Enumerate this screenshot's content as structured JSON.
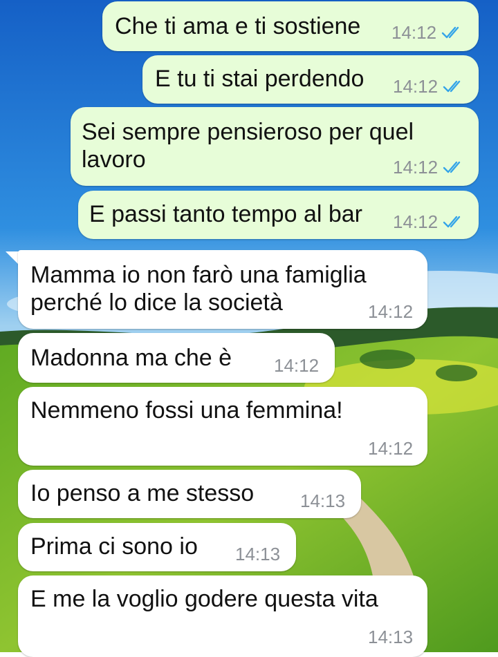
{
  "chat": {
    "colors": {
      "outgoing_bubble": "#e7fdd8",
      "incoming_bubble": "#ffffff",
      "timestamp": "#8c9096",
      "read_tick": "#34a4e8"
    },
    "background": {
      "description_icon": "landscape-wallpaper"
    },
    "messages": [
      {
        "direction": "outgoing",
        "text": "Che ti ama e ti sostiene",
        "time": "14:12",
        "status": "read"
      },
      {
        "direction": "outgoing",
        "text": "E tu ti stai perdendo",
        "time": "14:12",
        "status": "read"
      },
      {
        "direction": "outgoing",
        "text": "Sei sempre pensieroso per quel\nlavoro",
        "time": "14:12",
        "status": "read"
      },
      {
        "direction": "outgoing",
        "text": "E passi tanto tempo al bar",
        "time": "14:12",
        "status": "read"
      },
      {
        "direction": "incoming",
        "text": "Mamma io non farò una famiglia\nperché lo dice la società",
        "time": "14:12"
      },
      {
        "direction": "incoming",
        "text": "Madonna ma che è",
        "time": "14:12"
      },
      {
        "direction": "incoming",
        "text": "Nemmeno fossi una femmina!",
        "time": "14:12"
      },
      {
        "direction": "incoming",
        "text": "Io penso a me stesso",
        "time": "14:13"
      },
      {
        "direction": "incoming",
        "text": "Prima ci sono io",
        "time": "14:13"
      },
      {
        "direction": "incoming",
        "text": "E me la voglio godere questa vita",
        "time": "14:13"
      }
    ]
  }
}
